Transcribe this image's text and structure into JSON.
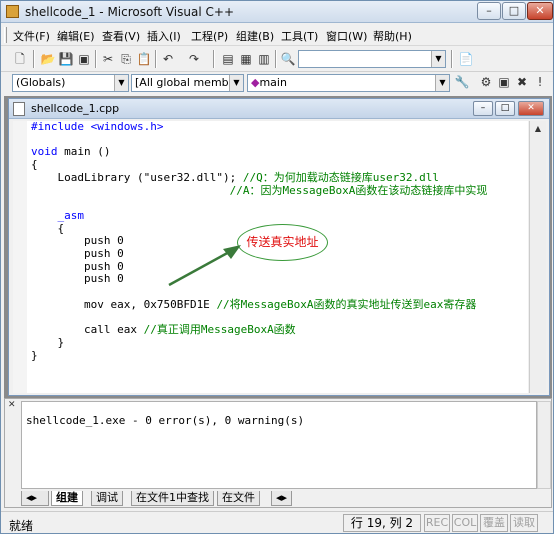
{
  "window": {
    "title": "shellcode_1 - Microsoft Visual C++"
  },
  "menu": [
    {
      "label": "文件(F)"
    },
    {
      "label": "编辑(E)"
    },
    {
      "label": "查看(V)"
    },
    {
      "label": "插入(I)"
    },
    {
      "label": "工程(P)"
    },
    {
      "label": "组建(B)"
    },
    {
      "label": "工具(T)"
    },
    {
      "label": "窗口(W)"
    },
    {
      "label": "帮助(H)"
    }
  ],
  "combos": {
    "globals": "(Globals)",
    "members": "[All global members",
    "function": "main"
  },
  "document": {
    "title": "shellcode_1.cpp"
  },
  "code": {
    "l1": "#include <windows.h>",
    "l2_kw": "void",
    "l2_rest": " main ()",
    "l3": "{",
    "l4_code": "    LoadLibrary (\"user32.dll\"); ",
    "l4_cm": "//Q：为何加载动态链接库user32.dll",
    "l5_cm": "                              //A：因为MessageBoxA函数在该动态链接库中实现",
    "l6": "",
    "l7_kw": "    _asm",
    "l8": "    {",
    "l9": "        push 0",
    "l10": "        push 0",
    "l11": "        push 0",
    "l12": "        push 0",
    "l13": "",
    "l14_code": "        mov eax, 0x750BFD1E ",
    "l14_cm": "//将MessageBoxA函数的真实地址传送到eax寄存器",
    "l15": "",
    "l16_code": "        call eax ",
    "l16_cm": "//真正调用MessageBoxA函数",
    "l17": "    }",
    "l18": "}"
  },
  "annotation": {
    "callout": "传送真实地址"
  },
  "output": {
    "line": "shellcode_1.exe - 0 error(s), 0 warning(s)"
  },
  "output_tabs": [
    {
      "label": "组建"
    },
    {
      "label": "调试"
    },
    {
      "label": "在文件1中查找"
    },
    {
      "label": "在文件"
    }
  ],
  "status": {
    "text": "就绪",
    "position": "行 19, 列 2",
    "rec": "REC",
    "col": "COL",
    "ovr": "覆盖",
    "read": "读取"
  }
}
